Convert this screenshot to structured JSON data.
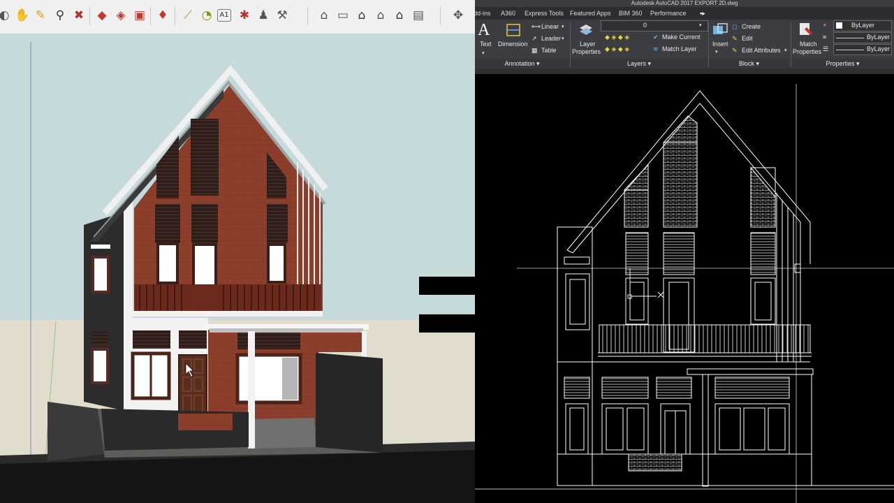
{
  "sketchup": {
    "toolbar_icons": [
      "orbit-icon",
      "pan-hand-icon",
      "zoom-icon",
      "zoom-extents-icon",
      "section-plane-icon",
      "section-cut-icon",
      "section-fill-icon",
      "ruby-gem-icon",
      "tape-measure-icon",
      "protractor-icon",
      "text-label-icon",
      "axes-icon",
      "dimension-icon",
      "walk-icon",
      "iso-view-icon",
      "top-view-icon",
      "front-view-icon",
      "right-view-icon",
      "back-view-icon",
      "left-view-icon",
      "position-camera-icon"
    ]
  },
  "autocad": {
    "window_title": "Autodesk AutoCAD 2017    EXPORT 2D.dwg",
    "tabs": [
      "dd-ins",
      "A360",
      "Express Tools",
      "Featured Apps",
      "BIM 360",
      "Performance"
    ],
    "annotation": {
      "text_label": "Text",
      "dimension_label": "Dimension",
      "linear_label": "Linear",
      "leader_label": "Leader",
      "table_label": "Table",
      "panel_label": "Annotation"
    },
    "layers": {
      "properties_label": "Layer",
      "properties_label2": "Properties",
      "current_layer": "0",
      "make_current_label": "Make Current",
      "match_layer_label": "Match Layer",
      "panel_label": "Layers"
    },
    "block": {
      "insert_label": "Insert",
      "create_label": "Create",
      "edit_label": "Edit",
      "edit_attributes_label": "Edit Attributes",
      "panel_label": "Block"
    },
    "properties": {
      "match_label": "Match",
      "match_label2": "Properties",
      "color_value": "ByLayer",
      "linetype_value": "ByLayer",
      "lineweight_value": "ByLayer",
      "panel_label": "Properties"
    },
    "colors": {
      "ribbon_bg": "#3b3d41",
      "canvas_bg": "#000000",
      "linework": "#ffffff"
    }
  },
  "scene": {
    "wall_brick_color": "#8e3f2c",
    "wall_dark_color": "#2c2c2c",
    "wall_white_color": "#f2f2f2",
    "sky_color": "#c6dadb",
    "ground_color": "#e2dccd"
  }
}
